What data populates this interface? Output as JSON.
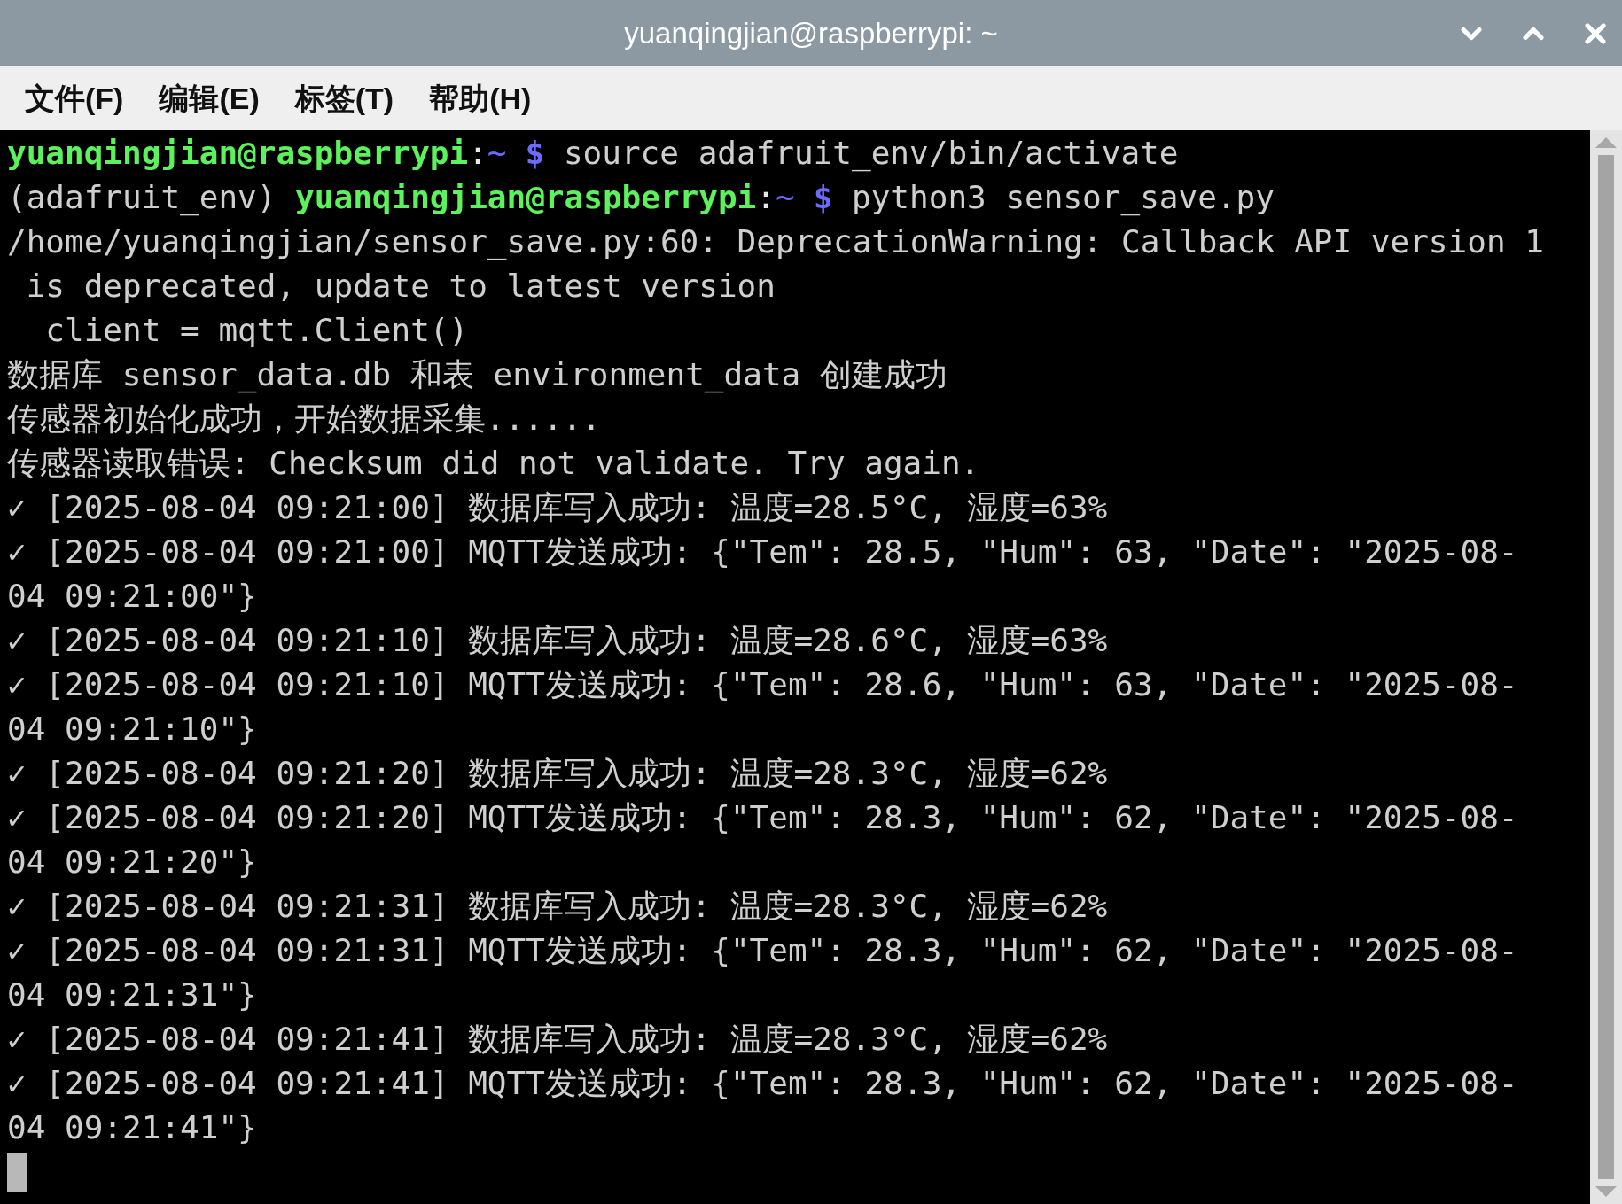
{
  "window": {
    "title": "yuanqingjian@raspberrypi: ~"
  },
  "menu": [
    "文件(F)",
    "编辑(E)",
    "标签(T)",
    "帮助(H)"
  ],
  "terminal": {
    "lines": [
      {
        "kind": "prompt",
        "user": "yuanqingjian@raspberrypi",
        "separator": ":",
        "cwd": "~",
        "sign": "$",
        "command": " source adafruit_env/bin/activate"
      },
      {
        "kind": "prompt",
        "env": "(adafruit_env) ",
        "user": "yuanqingjian@raspberrypi",
        "separator": ":",
        "cwd": "~",
        "sign": "$",
        "command": " python3 sensor_save.py"
      },
      {
        "kind": "output",
        "text": "/home/yuanqingjian/sensor_save.py:60: DeprecationWarning: Callback API version 1"
      },
      {
        "kind": "output",
        "text": " is deprecated, update to latest version"
      },
      {
        "kind": "output",
        "text": "  client = mqtt.Client()"
      },
      {
        "kind": "output",
        "text": "数据库 sensor_data.db 和表 environment_data 创建成功"
      },
      {
        "kind": "output",
        "text": "传感器初始化成功，开始数据采集......"
      },
      {
        "kind": "output",
        "text": "传感器读取错误: Checksum did not validate. Try again."
      },
      {
        "kind": "output",
        "text": "✓ [2025-08-04 09:21:00] 数据库写入成功: 温度=28.5°C, 湿度=63%"
      },
      {
        "kind": "output",
        "text": "✓ [2025-08-04 09:21:00] MQTT发送成功: {\"Tem\": 28.5, \"Hum\": 63, \"Date\": \"2025-08-"
      },
      {
        "kind": "output",
        "text": "04 09:21:00\"}"
      },
      {
        "kind": "output",
        "text": "✓ [2025-08-04 09:21:10] 数据库写入成功: 温度=28.6°C, 湿度=63%"
      },
      {
        "kind": "output",
        "text": "✓ [2025-08-04 09:21:10] MQTT发送成功: {\"Tem\": 28.6, \"Hum\": 63, \"Date\": \"2025-08-"
      },
      {
        "kind": "output",
        "text": "04 09:21:10\"}"
      },
      {
        "kind": "output",
        "text": "✓ [2025-08-04 09:21:20] 数据库写入成功: 温度=28.3°C, 湿度=62%"
      },
      {
        "kind": "output",
        "text": "✓ [2025-08-04 09:21:20] MQTT发送成功: {\"Tem\": 28.3, \"Hum\": 62, \"Date\": \"2025-08-"
      },
      {
        "kind": "output",
        "text": "04 09:21:20\"}"
      },
      {
        "kind": "output",
        "text": "✓ [2025-08-04 09:21:31] 数据库写入成功: 温度=28.3°C, 湿度=62%"
      },
      {
        "kind": "output",
        "text": "✓ [2025-08-04 09:21:31] MQTT发送成功: {\"Tem\": 28.3, \"Hum\": 62, \"Date\": \"2025-08-"
      },
      {
        "kind": "output",
        "text": "04 09:21:31\"}"
      },
      {
        "kind": "output",
        "text": "✓ [2025-08-04 09:21:41] 数据库写入成功: 温度=28.3°C, 湿度=62%"
      },
      {
        "kind": "output",
        "text": "✓ [2025-08-04 09:21:41] MQTT发送成功: {\"Tem\": 28.3, \"Hum\": 62, \"Date\": \"2025-08-"
      },
      {
        "kind": "output",
        "text": "04 09:21:41\"}"
      },
      {
        "kind": "cursor"
      }
    ]
  }
}
